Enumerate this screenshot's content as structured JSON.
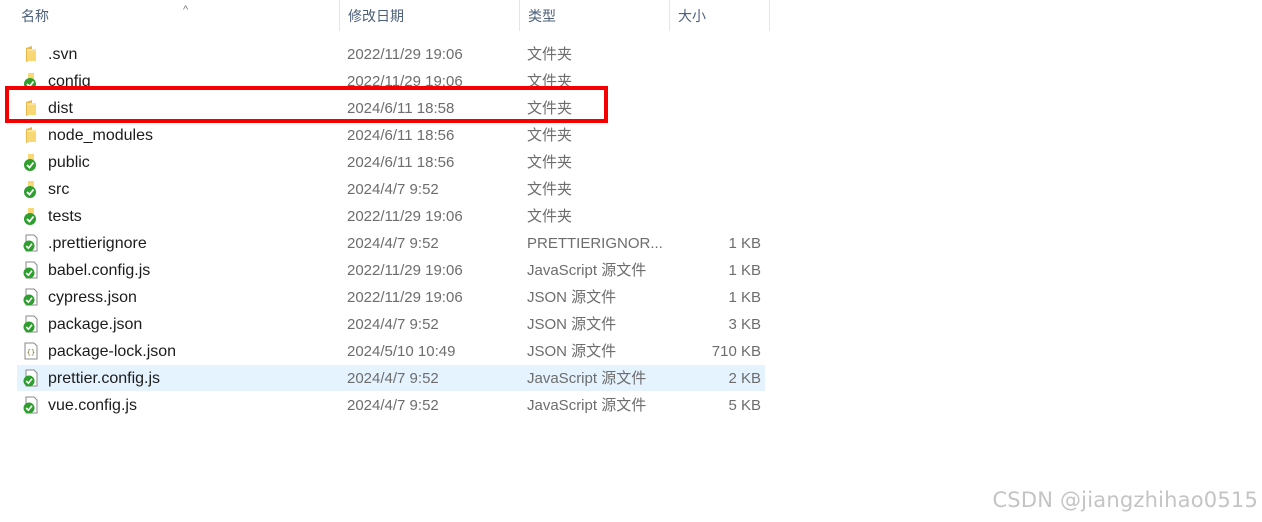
{
  "columns": {
    "name": "名称",
    "modified": "修改日期",
    "type": "类型",
    "size": "大小"
  },
  "files": [
    {
      "name": ".svn",
      "modified": "2022/11/29 19:06",
      "type": "文件夹",
      "size": "",
      "icon": "folder-icon"
    },
    {
      "name": "config",
      "modified": "2022/11/29 19:06",
      "type": "文件夹",
      "size": "",
      "icon": "folder-synced-icon"
    },
    {
      "name": "dist",
      "modified": "2024/6/11 18:58",
      "type": "文件夹",
      "size": "",
      "icon": "folder-icon"
    },
    {
      "name": "node_modules",
      "modified": "2024/6/11 18:56",
      "type": "文件夹",
      "size": "",
      "icon": "folder-icon"
    },
    {
      "name": "public",
      "modified": "2024/6/11 18:56",
      "type": "文件夹",
      "size": "",
      "icon": "folder-synced-icon"
    },
    {
      "name": "src",
      "modified": "2024/4/7 9:52",
      "type": "文件夹",
      "size": "",
      "icon": "folder-synced-icon"
    },
    {
      "name": "tests",
      "modified": "2022/11/29 19:06",
      "type": "文件夹",
      "size": "",
      "icon": "folder-synced-icon"
    },
    {
      "name": ".prettierignore",
      "modified": "2024/4/7 9:52",
      "type": "PRETTIERIGNOR...",
      "size": "1 KB",
      "icon": "file-synced-icon"
    },
    {
      "name": "babel.config.js",
      "modified": "2022/11/29 19:06",
      "type": "JavaScript 源文件",
      "size": "1 KB",
      "icon": "file-synced-icon"
    },
    {
      "name": "cypress.json",
      "modified": "2022/11/29 19:06",
      "type": "JSON 源文件",
      "size": "1 KB",
      "icon": "file-synced-icon"
    },
    {
      "name": "package.json",
      "modified": "2024/4/7 9:52",
      "type": "JSON 源文件",
      "size": "3 KB",
      "icon": "file-synced-icon"
    },
    {
      "name": "package-lock.json",
      "modified": "2024/5/10 10:49",
      "type": "JSON 源文件",
      "size": "710 KB",
      "icon": "json-file-icon"
    },
    {
      "name": "prettier.config.js",
      "modified": "2024/4/7 9:52",
      "type": "JavaScript 源文件",
      "size": "2 KB",
      "icon": "file-synced-icon"
    },
    {
      "name": "vue.config.js",
      "modified": "2024/4/7 9:52",
      "type": "JavaScript 源文件",
      "size": "5 KB",
      "icon": "file-synced-icon"
    }
  ],
  "selected_row": "prettier.config.js",
  "highlighted_row": "dist",
  "colors": {
    "highlight": "#f40000",
    "selection": "#e5f3ff",
    "folder": "#f8d775",
    "synced_badge": "#2e9e2e"
  },
  "watermark": "CSDN @jiangzhihao0515"
}
